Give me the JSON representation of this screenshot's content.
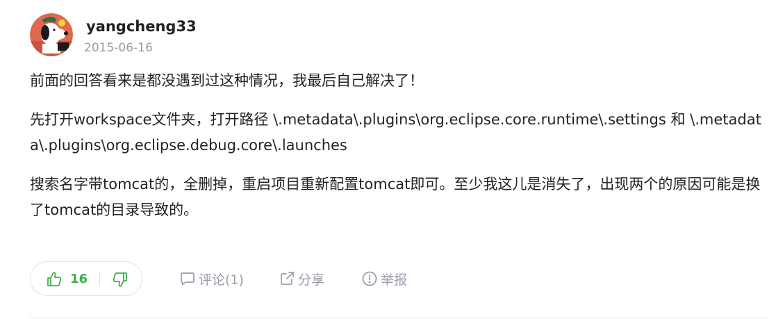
{
  "author": {
    "name": "yangcheng33",
    "date": "2015-06-16",
    "avatar_icon": "snoopy-avatar-icon"
  },
  "content": {
    "paragraphs": [
      "前面的回答看来是都没遇到过这种情况，我最后自己解决了！",
      "先打开workspace文件夹，打开路径 \\.metadata\\.plugins\\org.eclipse.core.runtime\\.settings 和 \\.metadata\\.plugins\\org.eclipse.debug.core\\.launches",
      "搜索名字带tomcat的，全删掉，重启项目重新配置tomcat即可。至少我这儿是消失了，出现两个的原因可能是换了tomcat的目录导致的。"
    ]
  },
  "actions": {
    "like_count": "16",
    "like_icon": "thumbs-up-icon",
    "dislike_icon": "thumbs-down-icon",
    "comment_label": "评论(1)",
    "comment_icon": "comment-icon",
    "share_label": "分享",
    "share_icon": "share-icon",
    "report_label": "举报",
    "report_icon": "report-icon"
  },
  "colors": {
    "like_green": "#3fae49",
    "muted_gray": "#999aaa",
    "text": "#222226"
  }
}
